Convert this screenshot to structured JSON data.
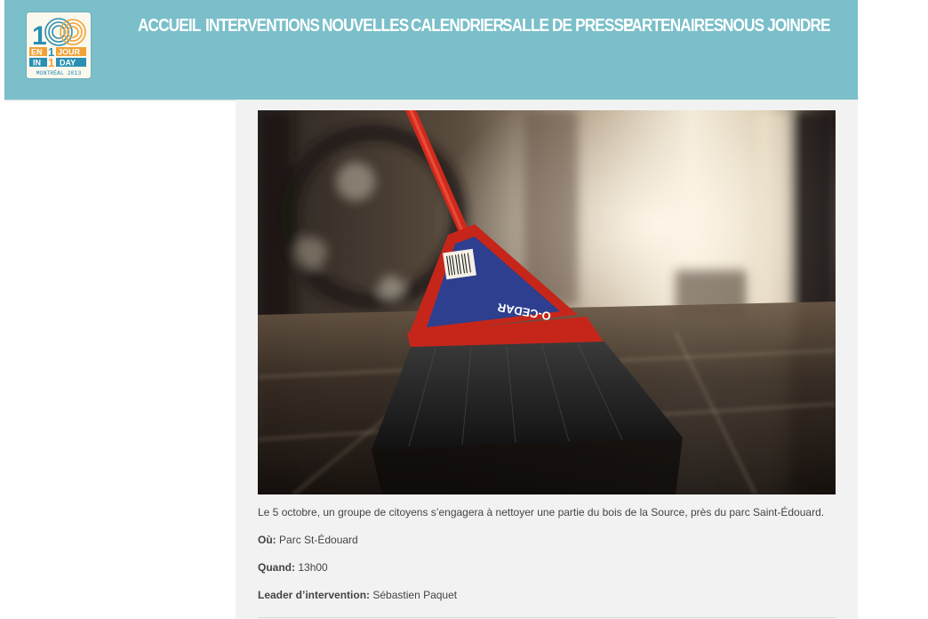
{
  "logo": {
    "top_left": "1",
    "top_right": "00",
    "row1_left": "EN",
    "row1_mid": "1",
    "row1_right": "JOUR",
    "row2_left": "IN",
    "row2_mid": "1",
    "row2_right": "DAY",
    "city": "MONTRÉAL 2013",
    "colors": {
      "blue": "#2a8fb3",
      "orange": "#f0a238"
    }
  },
  "nav": {
    "items": [
      {
        "label": "ACCUEIL"
      },
      {
        "label": "INTERVENTIONS"
      },
      {
        "label": "NOUVELLES"
      },
      {
        "label": "CALENDRIER"
      },
      {
        "label": "SALLE DE PRESSE"
      },
      {
        "label": "PARTENAIRES"
      },
      {
        "label": "NOUS JOINDRE"
      }
    ]
  },
  "photo": {
    "brand_text": "O-CEDAR"
  },
  "article": {
    "description": "Le 5 octobre, un groupe de citoyens s’engagera à nettoyer une partie du bois de la Source, près du parc Saint-Édouard.",
    "where_label": "Où:",
    "where_value": "Parc St-Édouard",
    "when_label": "Quand:",
    "when_value": "13h00",
    "leader_label": "Leader d’intervention:",
    "leader_value": "Sébastien Paquet"
  },
  "colors": {
    "header_bg": "#7abfc9",
    "content_bg": "#f2f2f2",
    "text": "#444444"
  }
}
